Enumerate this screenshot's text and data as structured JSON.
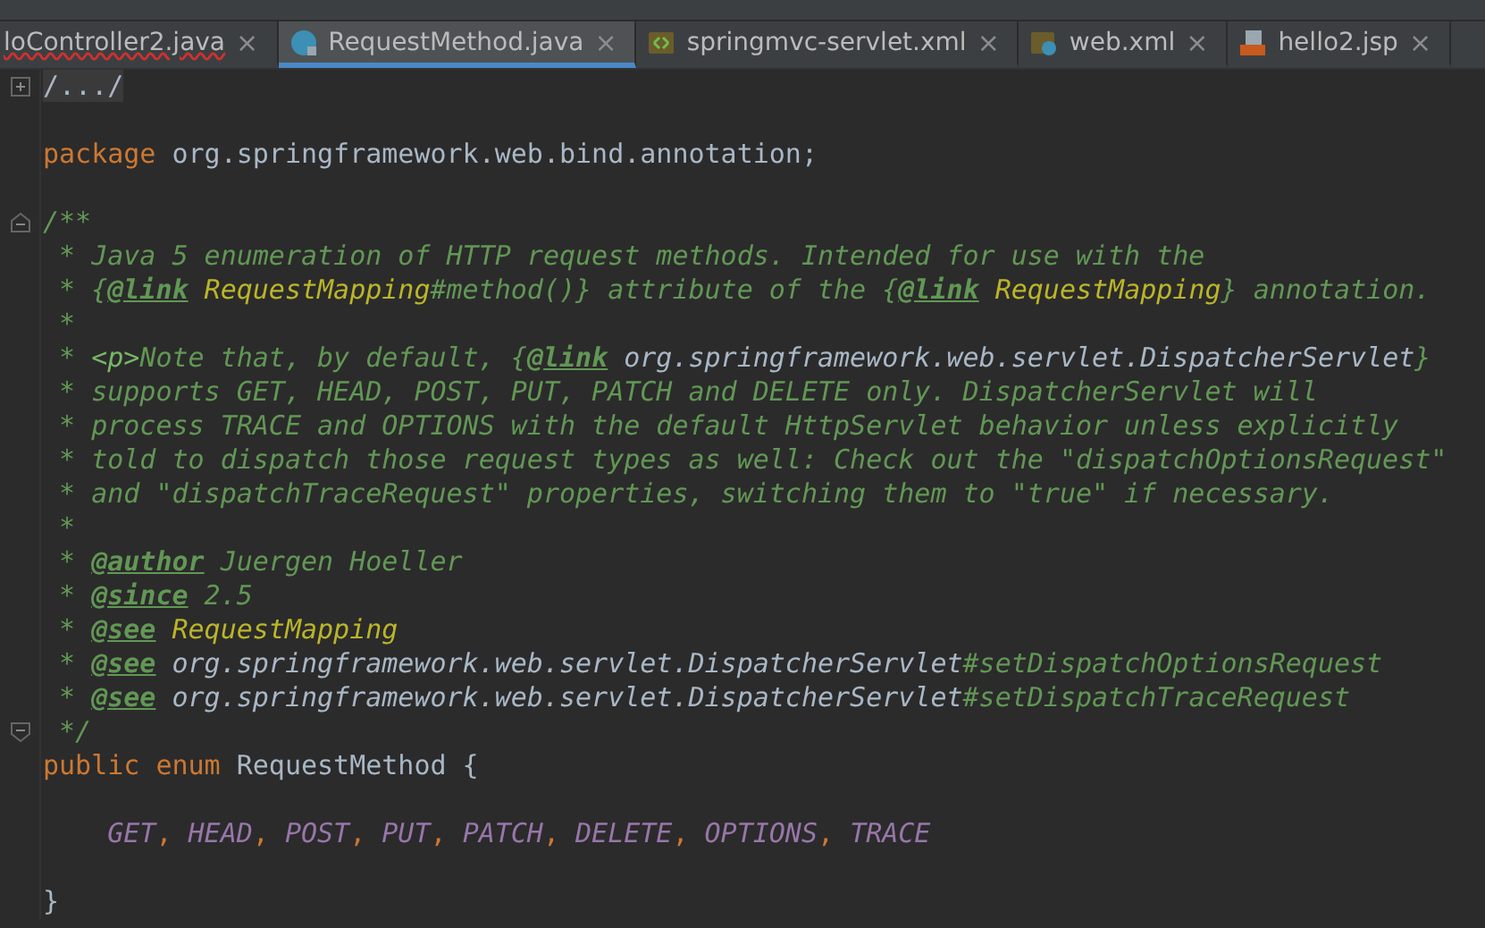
{
  "tabs": [
    {
      "label": "loController2.java",
      "kind": "plain",
      "selected": false,
      "error": true
    },
    {
      "label": "RequestMethod.java",
      "kind": "enum",
      "selected": true,
      "error": false
    },
    {
      "label": "springmvc-servlet.xml",
      "kind": "xml",
      "selected": false,
      "error": false
    },
    {
      "label": "web.xml",
      "kind": "webxml",
      "selected": false,
      "error": false
    },
    {
      "label": "hello2.jsp",
      "kind": "jsp",
      "selected": false,
      "error": false
    }
  ],
  "close_glyph": "×",
  "editor": {
    "lines": [
      {
        "kind": "fold-expand",
        "tokens": [
          {
            "kind": "folded",
            "text": "/.../"
          }
        ]
      },
      {
        "kind": "code"
      },
      {
        "kind": "code",
        "tokens": [
          {
            "kind": "keyword",
            "text": "package "
          },
          {
            "kind": "plain",
            "text": "org.springframework.web.bind.annotation;"
          }
        ]
      },
      {
        "kind": "code"
      },
      {
        "kind": "fold-start",
        "tokens": [
          {
            "kind": "comment",
            "text": "/**"
          }
        ]
      },
      {
        "kind": "code",
        "tokens": [
          {
            "kind": "comment",
            "text": " * Java 5 enumeration of HTTP request methods. Intended for use with the"
          }
        ]
      },
      {
        "kind": "code",
        "tokens": [
          {
            "kind": "comment",
            "text": " * {"
          },
          {
            "kind": "tag",
            "text": "@link"
          },
          {
            "kind": "ref",
            "text": " RequestMapping"
          },
          {
            "kind": "comment",
            "text": "#method()} attribute of the {"
          },
          {
            "kind": "tag",
            "text": "@link"
          },
          {
            "kind": "ref",
            "text": " RequestMapping"
          },
          {
            "kind": "comment",
            "text": "} annotation."
          }
        ]
      },
      {
        "kind": "code",
        "tokens": [
          {
            "kind": "comment",
            "text": " *"
          }
        ]
      },
      {
        "kind": "code",
        "tokens": [
          {
            "kind": "comment",
            "text": " * "
          },
          {
            "kind": "markup",
            "text": "<p>"
          },
          {
            "kind": "comment",
            "text": "Note that, by default, {"
          },
          {
            "kind": "tag",
            "text": "@link"
          },
          {
            "kind": "doc-code",
            "text": " org.springframework.web.servlet.DispatcherServlet"
          },
          {
            "kind": "comment",
            "text": "}"
          }
        ]
      },
      {
        "kind": "code",
        "tokens": [
          {
            "kind": "comment",
            "text": " * supports GET, HEAD, POST, PUT, PATCH and DELETE only. DispatcherServlet will"
          }
        ]
      },
      {
        "kind": "code",
        "tokens": [
          {
            "kind": "comment",
            "text": " * process TRACE and OPTIONS with the default HttpServlet behavior unless explicitly"
          }
        ]
      },
      {
        "kind": "code",
        "tokens": [
          {
            "kind": "comment",
            "text": " * told to dispatch those request types as well: Check out the \"dispatchOptionsRequest\""
          }
        ]
      },
      {
        "kind": "code",
        "tokens": [
          {
            "kind": "comment",
            "text": " * and \"dispatchTraceRequest\" properties, switching them to \"true\" if necessary."
          }
        ]
      },
      {
        "kind": "code",
        "tokens": [
          {
            "kind": "comment",
            "text": " *"
          }
        ]
      },
      {
        "kind": "code",
        "tokens": [
          {
            "kind": "comment",
            "text": " * "
          },
          {
            "kind": "tag",
            "text": "@author"
          },
          {
            "kind": "comment",
            "text": " Juergen Hoeller"
          }
        ]
      },
      {
        "kind": "code",
        "tokens": [
          {
            "kind": "comment",
            "text": " * "
          },
          {
            "kind": "tag",
            "text": "@since"
          },
          {
            "kind": "comment",
            "text": " 2.5"
          }
        ]
      },
      {
        "kind": "code",
        "tokens": [
          {
            "kind": "comment",
            "text": " * "
          },
          {
            "kind": "tag",
            "text": "@see"
          },
          {
            "kind": "ref",
            "text": " RequestMapping"
          }
        ]
      },
      {
        "kind": "code",
        "tokens": [
          {
            "kind": "comment",
            "text": " * "
          },
          {
            "kind": "tag",
            "text": "@see"
          },
          {
            "kind": "doc-code",
            "text": " org.springframework.web.servlet.DispatcherServlet"
          },
          {
            "kind": "comment",
            "text": "#setDispatchOptionsRequest"
          }
        ]
      },
      {
        "kind": "code",
        "tokens": [
          {
            "kind": "comment",
            "text": " * "
          },
          {
            "kind": "tag",
            "text": "@see"
          },
          {
            "kind": "doc-code",
            "text": " org.springframework.web.servlet.DispatcherServlet"
          },
          {
            "kind": "comment",
            "text": "#setDispatchTraceRequest"
          }
        ]
      },
      {
        "kind": "fold-end",
        "tokens": [
          {
            "kind": "comment",
            "text": " */"
          }
        ]
      },
      {
        "kind": "code",
        "tokens": [
          {
            "kind": "keyword",
            "text": "public enum "
          },
          {
            "kind": "plain",
            "text": "RequestMethod {"
          }
        ]
      },
      {
        "kind": "code"
      },
      {
        "kind": "code",
        "tokens": [
          {
            "kind": "constant",
            "text": "    GET"
          },
          {
            "kind": "keyword",
            "text": ", "
          },
          {
            "kind": "constant",
            "text": "HEAD"
          },
          {
            "kind": "keyword",
            "text": ", "
          },
          {
            "kind": "constant",
            "text": "POST"
          },
          {
            "kind": "keyword",
            "text": ", "
          },
          {
            "kind": "constant",
            "text": "PUT"
          },
          {
            "kind": "keyword",
            "text": ", "
          },
          {
            "kind": "constant",
            "text": "PATCH"
          },
          {
            "kind": "keyword",
            "text": ", "
          },
          {
            "kind": "constant",
            "text": "DELETE"
          },
          {
            "kind": "keyword",
            "text": ", "
          },
          {
            "kind": "constant",
            "text": "OPTIONS"
          },
          {
            "kind": "keyword",
            "text": ", "
          },
          {
            "kind": "constant",
            "text": "TRACE"
          }
        ]
      },
      {
        "kind": "code"
      },
      {
        "kind": "code",
        "tokens": [
          {
            "kind": "plain",
            "text": "}"
          }
        ]
      }
    ]
  }
}
